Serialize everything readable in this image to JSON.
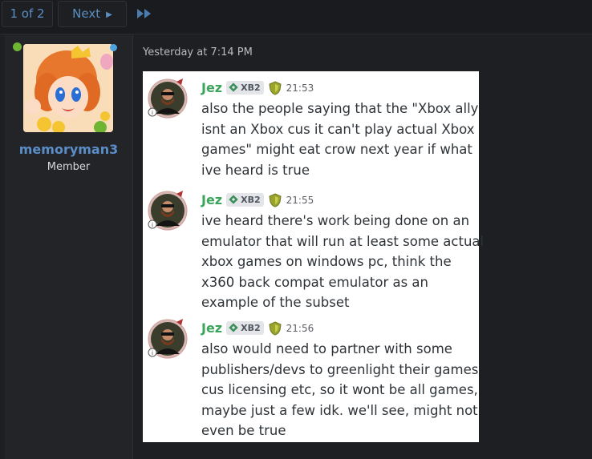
{
  "pagination": {
    "current": "1 of 2",
    "next_label": "Next"
  },
  "colors": {
    "link": "#5a8fbf",
    "author": "#3ba55c",
    "online": "#6fb533"
  },
  "user": {
    "name": "memoryman3",
    "title": "Member"
  },
  "post": {
    "timestamp": "Yesterday at 7:14 PM"
  },
  "messages": [
    {
      "author": "Jez",
      "tag": "XB2",
      "time": "21:53",
      "lines": [
        "also the people saying that the \"Xbox ally",
        "isnt an Xbox cus it can't play actual Xbox",
        "games\" might eat crow next year if what",
        "ive heard is true"
      ]
    },
    {
      "author": "Jez",
      "tag": "XB2",
      "time": "21:55",
      "lines": [
        "ive heard there's work being done on an",
        "emulator that will run at least some actual",
        "xbox games on windows pc, think the",
        "x360 back compat emulator as an",
        "example of the subset"
      ]
    },
    {
      "author": "Jez",
      "tag": "XB2",
      "time": "21:56",
      "lines": [
        "also would need to partner with some",
        "publishers/devs to greenlight their games",
        "cus licensing etc, so it wont be all games,",
        "maybe just a few idk. we'll see, might not",
        "even be true"
      ]
    }
  ]
}
